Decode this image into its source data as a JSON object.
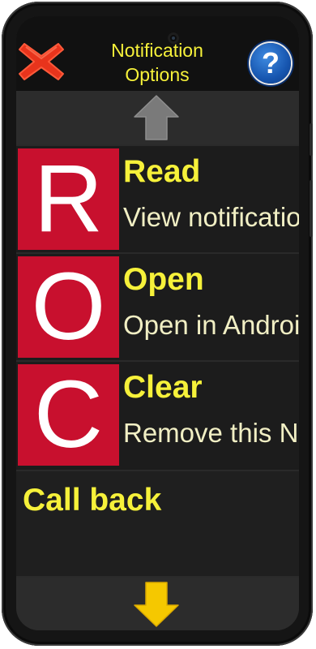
{
  "header": {
    "title_line1": "Notification",
    "title_line2": "Options",
    "help_label": "?"
  },
  "options": [
    {
      "letter": "R",
      "title": "Read",
      "description": "View notification"
    },
    {
      "letter": "O",
      "title": "Open",
      "description": "Open in Android"
    },
    {
      "letter": "C",
      "title": "Clear",
      "description": "Remove this Notification"
    }
  ],
  "callback": {
    "label": "Call back"
  },
  "icons": {
    "close": "close-icon",
    "help": "help-icon",
    "scroll_up": "arrow-up-icon",
    "scroll_down": "arrow-down-icon"
  },
  "colors": {
    "accent_yellow": "#f6f13a",
    "letter_red": "#c8102e",
    "close_red": "#e8341c",
    "help_blue": "#1756b0",
    "arrow_gray": "#7a7a7a",
    "arrow_yellow": "#f5c800"
  }
}
